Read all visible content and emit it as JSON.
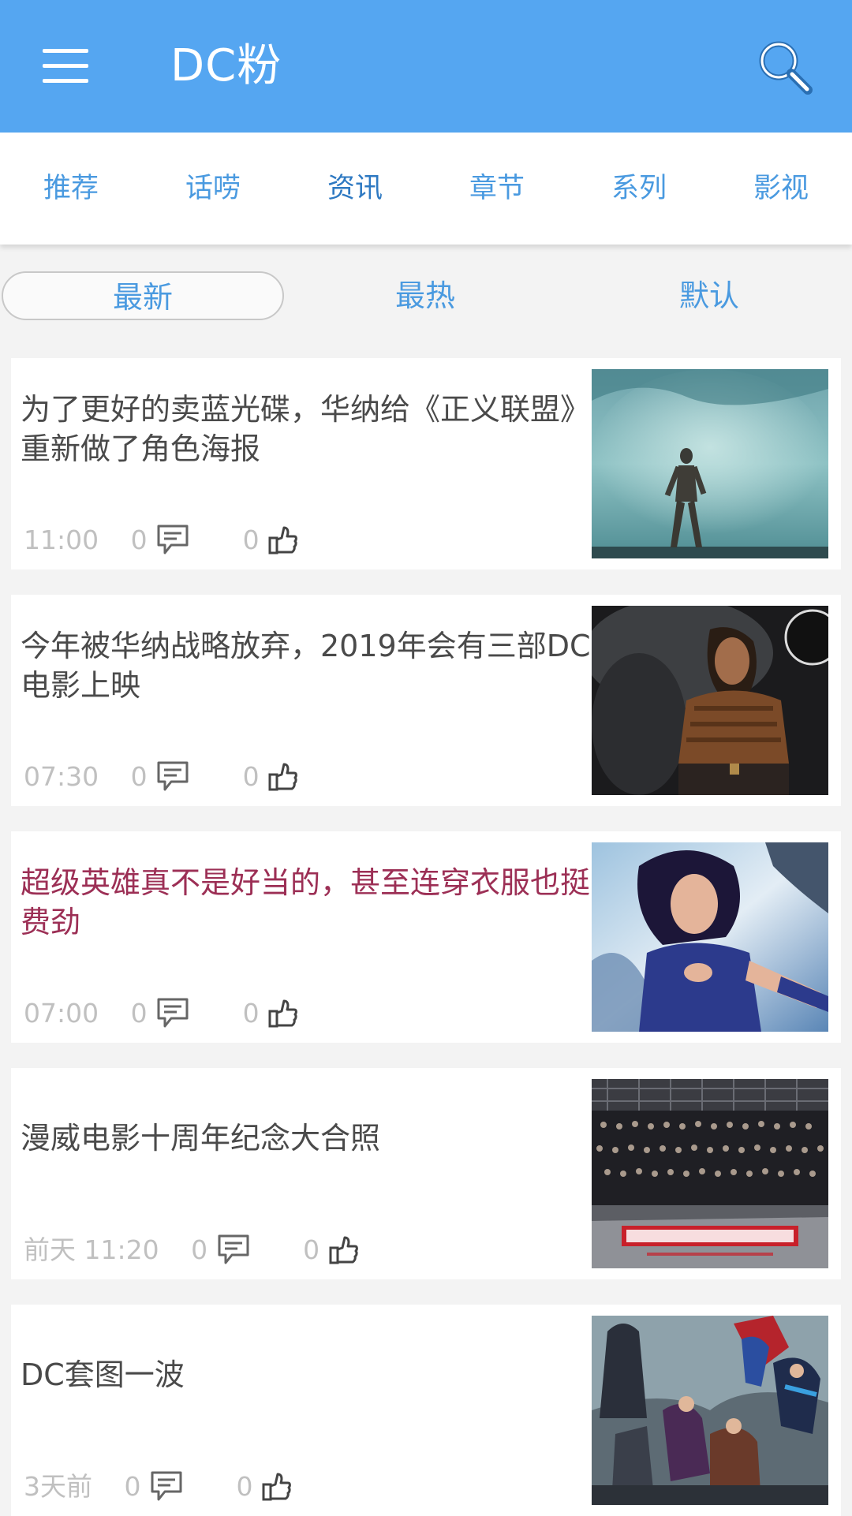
{
  "app_bar": {
    "title": "DC粉",
    "menu_icon": "hamburger-menu-icon",
    "search_icon": "search-icon",
    "color": "#55a6f1"
  },
  "tabs": [
    {
      "label": "推荐"
    },
    {
      "label": "话唠"
    },
    {
      "label": "资讯",
      "active": true
    },
    {
      "label": "章节"
    },
    {
      "label": "系列"
    },
    {
      "label": "影视"
    }
  ],
  "sort": [
    {
      "label": "最新",
      "active": true
    },
    {
      "label": "最热"
    },
    {
      "label": "默认"
    }
  ],
  "articles": [
    {
      "title": "为了更好的卖蓝光碟，华纳给《正义联盟》重新做了角色海报",
      "time": "11:00",
      "comments": "0",
      "likes": "0",
      "thumbnail": "hero-standing-in-waves-image"
    },
    {
      "title": "今年被华纳战略放弃，2019年会有三部DC电影上映",
      "time": "07:30",
      "comments": "0",
      "likes": "0",
      "thumbnail": "aquaman-portrait-image"
    },
    {
      "title": "超级英雄真不是好当的，甚至连穿衣服也挺费劲",
      "time": "07:00",
      "comments": "0",
      "likes": "0",
      "thumbnail": "psylocke-portrait-image",
      "visited": true
    },
    {
      "title": "漫威电影十周年纪念大合照",
      "time": "前天 11:20",
      "comments": "0",
      "likes": "0",
      "thumbnail": "marvel-studios-group-photo-image"
    },
    {
      "title": "DC套图一波",
      "time": "3天前",
      "comments": "0",
      "likes": "0",
      "thumbnail": "dc-heroes-artwork-image"
    }
  ],
  "colors": {
    "accent": "#4a9ae0",
    "visited_title": "#9c2f55",
    "meta_text": "#c0c0c0"
  }
}
